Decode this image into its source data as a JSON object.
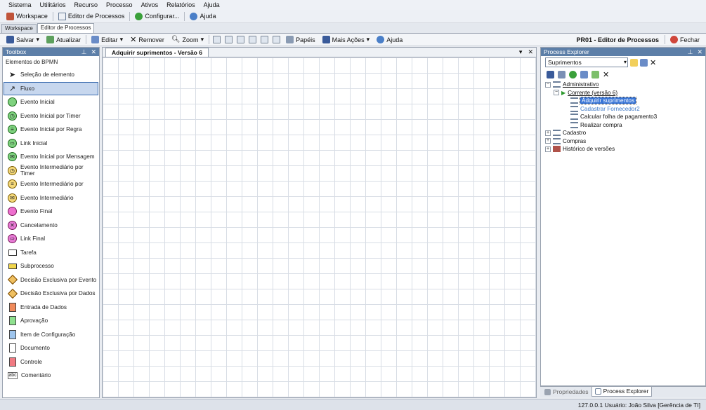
{
  "menu": [
    "Sistema",
    "Utilitários",
    "Recurso",
    "Processo",
    "Ativos",
    "Relatórios",
    "Ajuda"
  ],
  "toolbar1": {
    "workspace": "Workspace",
    "editor": "Editor de Processos",
    "configurar": "Configurar...",
    "ajuda": "Ajuda"
  },
  "doc_tabs": [
    "Workspace",
    "Editor de Processos"
  ],
  "toolbar2": {
    "salvar": "Salvar",
    "atualizar": "Atualizar",
    "editar": "Editar",
    "remover": "Remover",
    "zoom": "Zoom",
    "papeis": "Papéis",
    "mais_acoes": "Mais Ações",
    "ajuda": "Ajuda",
    "title": "PR01 - Editor de Processos",
    "fechar": "Fechar"
  },
  "toolbox": {
    "title": "Toolbox",
    "group": "Elementos do BPMN",
    "items": [
      "Seleção de elemento",
      "Fluxo",
      "Evento Inicial",
      "Evento Inicial por Timer",
      "Evento Inicial por Regra",
      "Link Inicial",
      "Evento Inicial por Mensagem",
      "Evento Intermediário por Timer",
      "Evento Intermediário por",
      "Evento Intermediário",
      "Evento Final",
      "Cancelamento",
      "Link Final",
      "Tarefa",
      "Subprocesso",
      "Decisão Exclusiva por Evento",
      "Decisão Exclusiva por Dados",
      "Entrada de Dados",
      "Aprovação",
      "Item de Configuração",
      "Documento",
      "Controle",
      "Comentário"
    ]
  },
  "editor": {
    "tab": "Adquirir suprimentos - Versão 6"
  },
  "explorer": {
    "title": "Process Explorer",
    "combo": "Suprimentos",
    "tree": {
      "administrativo": "Administrativo",
      "corrente": "Corrente (versão 6)",
      "adquirir": "Adquirir suprimentos",
      "cadastrar": "Cadastrar Fornecedor2",
      "calcular": "Calcular folha de pagamento3",
      "realizar": "Realizar compra",
      "cadastro": "Cadastro",
      "compras": "Compras",
      "historico": "Histórico de versões"
    }
  },
  "bottom_tabs": {
    "propriedades": "Propriedades",
    "explorer": "Process Explorer"
  },
  "status": "127.0.0.1   Usuário: João Silva [Gerência de TI]"
}
